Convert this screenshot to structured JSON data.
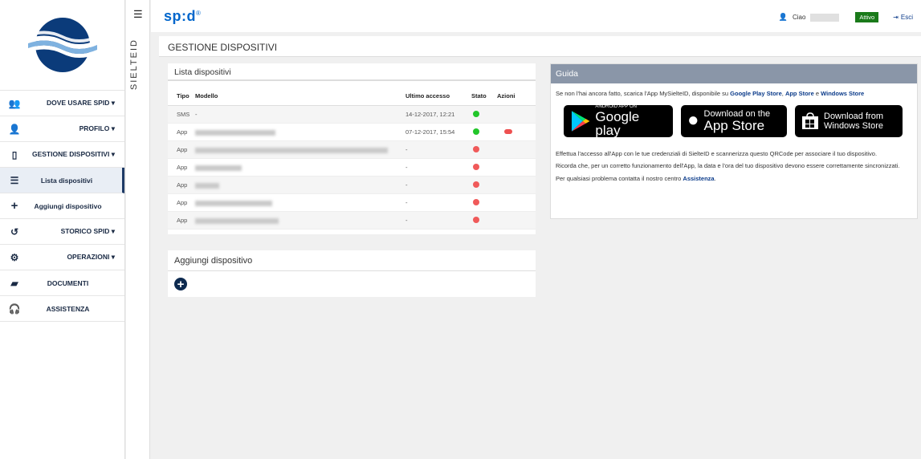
{
  "sidebar": {
    "brand": "SIELTEID",
    "items": [
      {
        "label": "DOVE USARE SPID",
        "icon": "people-icon",
        "chevron": "▾"
      },
      {
        "label": "PROFILO",
        "icon": "user-icon",
        "chevron": "▾"
      },
      {
        "label": "GESTIONE DISPOSITIVI",
        "icon": "mobile-icon",
        "chevron": "▾"
      },
      {
        "label": "Lista dispositivi",
        "icon": "list-icon"
      },
      {
        "label": "Aggiungi dispositivo",
        "icon": "plus-icon"
      },
      {
        "label": "STORICO SPID",
        "icon": "history-icon",
        "chevron": "▾"
      },
      {
        "label": "OPERAZIONI",
        "icon": "cogs-icon",
        "chevron": "▾"
      },
      {
        "label": "DOCUMENTI",
        "icon": "book-icon"
      },
      {
        "label": "ASSISTENZA",
        "icon": "headset-icon"
      }
    ]
  },
  "header": {
    "logo": "sp:d",
    "greeting": "Ciao",
    "status": "Attivo",
    "logout": "Esci"
  },
  "page": {
    "title": "GESTIONE DISPOSITIVI"
  },
  "devices": {
    "title": "Lista dispositivi",
    "columns": [
      "Tipo",
      "Modello",
      "Ultimo accesso",
      "Stato",
      "Azioni"
    ],
    "rows": [
      {
        "tipo": "SMS",
        "modello": "-",
        "accesso": "14-12-2017, 12:21",
        "stato": "green"
      },
      {
        "tipo": "App",
        "modello": "",
        "accesso": "07-12-2017, 15:54",
        "stato": "green",
        "azione": true
      },
      {
        "tipo": "App",
        "modello": "",
        "accesso": "-",
        "stato": "red"
      },
      {
        "tipo": "App",
        "modello": "",
        "accesso": "-",
        "stato": "red"
      },
      {
        "tipo": "App",
        "modello": "",
        "accesso": "-",
        "stato": "red"
      },
      {
        "tipo": "App",
        "modello": "",
        "accesso": "-",
        "stato": "red"
      },
      {
        "tipo": "App",
        "modello": "",
        "accesso": "-",
        "stato": "red"
      }
    ]
  },
  "add": {
    "title": "Aggiungi dispositivo"
  },
  "guide": {
    "title": "Guida",
    "intro_pre": "Se non l'hai ancora fatto, scarica l'App MySielteID, disponibile su ",
    "link_play": "Google Play Store",
    "sep1": ", ",
    "link_app": "App Store",
    "sep2": " e ",
    "link_win": "Windows Store",
    "badge_play_small": "ANDROID APP ON",
    "badge_play_big": "Google play",
    "badge_apple_small": "Download on the",
    "badge_apple_big": "App Store",
    "badge_win_small": "Download from",
    "badge_win_big": "Windows Store",
    "p2": "Effettua l'accesso all'App con le tue credenziali di SielteID e scannerizza questo QRCode per associare il tuo dispositivo.",
    "p3": "Ricorda che, per un corretto funzionamento dell'App, la data e l'ora del tuo dispositivo devono essere correttamente sincronizzati.",
    "p4_pre": "Per qualsiasi problema contatta il nostro centro ",
    "p4_link": "Assistenza",
    "p4_post": "."
  }
}
